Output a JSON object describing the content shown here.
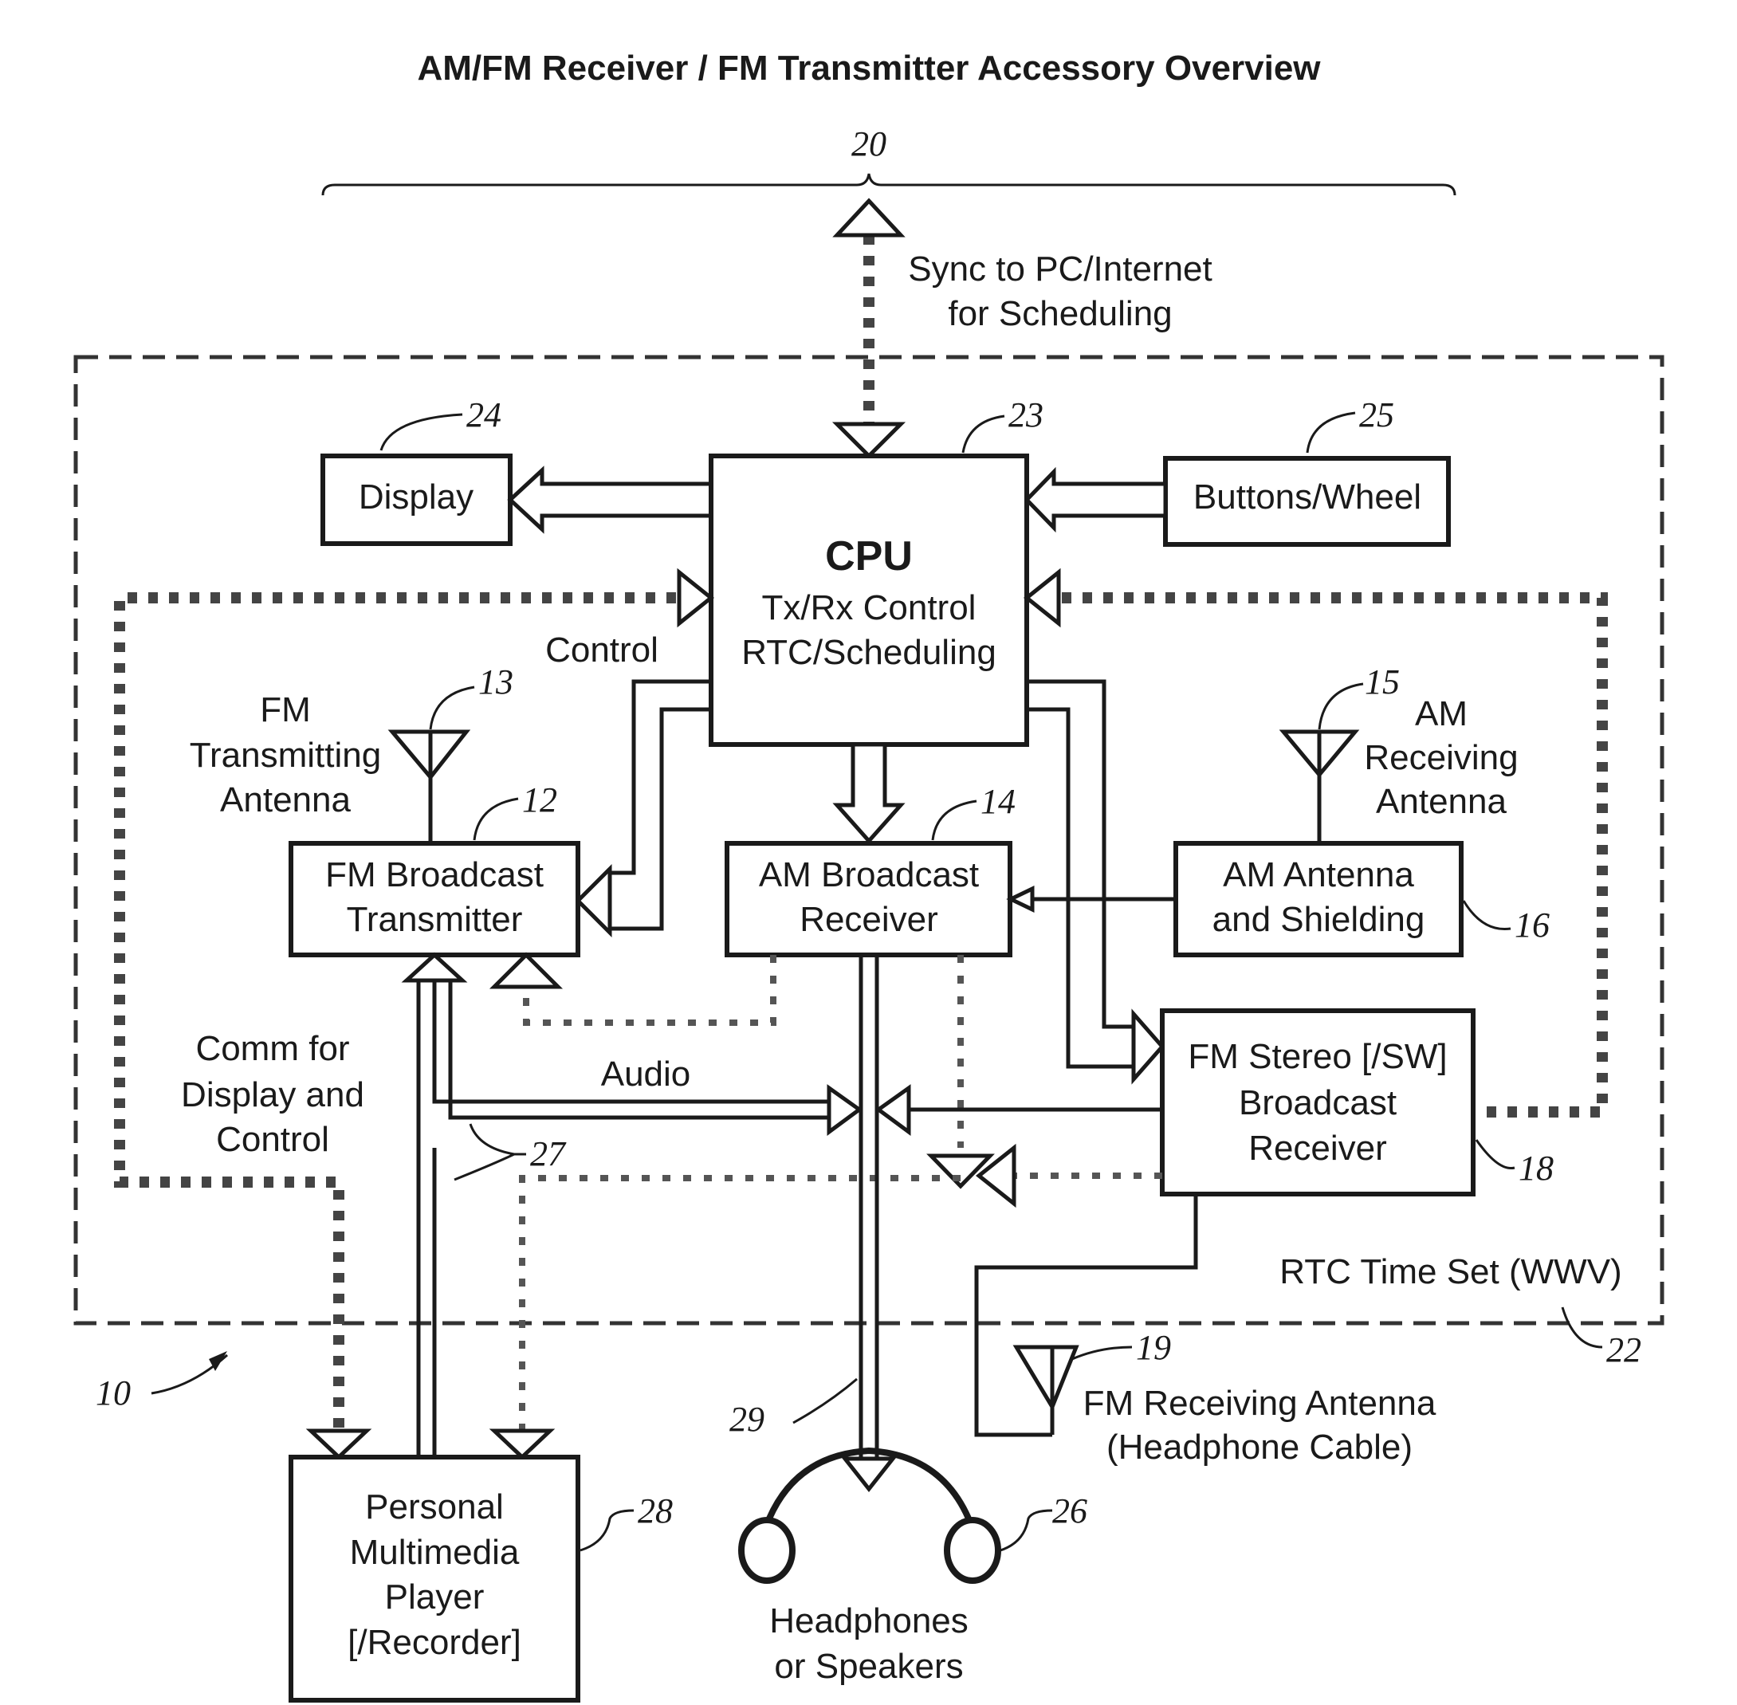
{
  "title": "AM/FM Receiver / FM Transmitter Accessory Overview",
  "refs": {
    "system": "10",
    "fm_tx": "12",
    "fm_tx_antenna": "13",
    "am_rx": "14",
    "am_antenna": "15",
    "am_shield": "16",
    "fm_rx": "18",
    "fm_rx_antenna": "19",
    "bracket": "20",
    "enclosure": "22",
    "cpu": "23",
    "display": "24",
    "buttons": "25",
    "headphones": "26",
    "audio_bus": "27",
    "pmp": "28",
    "audio_out": "29"
  },
  "blocks": {
    "display": "Display",
    "buttons": "Buttons/Wheel",
    "cpu_title": "CPU",
    "cpu_line1": "Tx/Rx Control",
    "cpu_line2": "RTC/Scheduling",
    "fm_tx_line1": "FM Broadcast",
    "fm_tx_line2": "Transmitter",
    "am_rx_line1": "AM Broadcast",
    "am_rx_line2": "Receiver",
    "am_ant_line1": "AM Antenna",
    "am_ant_line2": "and Shielding",
    "fm_rx_line1": "FM Stereo [/SW]",
    "fm_rx_line2": "Broadcast",
    "fm_rx_line3": "Receiver",
    "pmp_line1": "Personal",
    "pmp_line2": "Multimedia",
    "pmp_line3": "Player",
    "pmp_line4": "[/Recorder]"
  },
  "labels": {
    "sync_line1": "Sync to PC/Internet",
    "sync_line2": "for Scheduling",
    "control": "Control",
    "fm_tx_ant_line1": "FM",
    "fm_tx_ant_line2": "Transmitting",
    "fm_tx_ant_line3": "Antenna",
    "am_ant_line1": "AM",
    "am_ant_line2": "Receiving",
    "am_ant_line3": "Antenna",
    "comm_line1": "Comm for",
    "comm_line2": "Display and",
    "comm_line3": "Control",
    "audio": "Audio",
    "rtc_time_set": "RTC Time Set (WWV)",
    "fm_rx_ant_line1": "FM Receiving Antenna",
    "fm_rx_ant_line2": "(Headphone Cable)",
    "headphones_line1": "Headphones",
    "headphones_line2": "or Speakers"
  }
}
